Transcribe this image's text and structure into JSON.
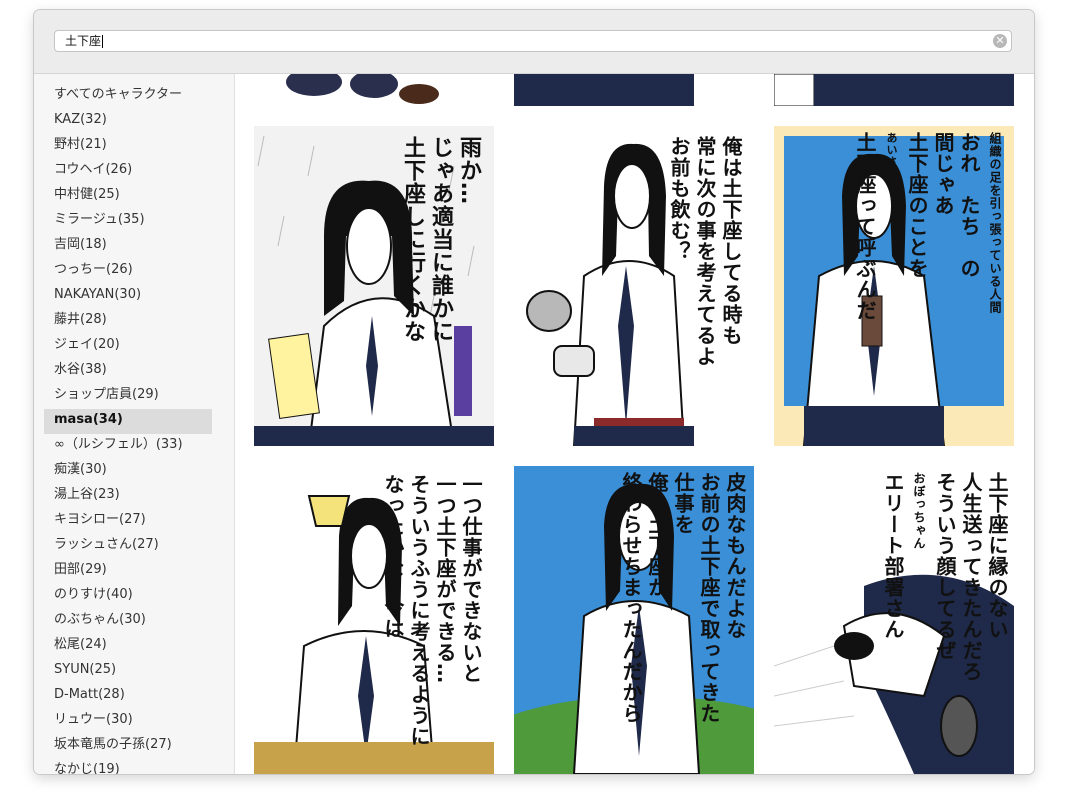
{
  "search": {
    "value": "土下座"
  },
  "sidebar": {
    "items": [
      {
        "label": "すべてのキャラクター"
      },
      {
        "label": "KAZ(32)"
      },
      {
        "label": "野村(21)"
      },
      {
        "label": "コウヘイ(26)"
      },
      {
        "label": "中村健(25)"
      },
      {
        "label": "ミラージュ(35)"
      },
      {
        "label": "吉岡(18)"
      },
      {
        "label": "つっちー(26)"
      },
      {
        "label": "NAKAYAN(30)"
      },
      {
        "label": "藤井(28)"
      },
      {
        "label": "ジェイ(20)"
      },
      {
        "label": "水谷(38)"
      },
      {
        "label": "ショップ店員(29)"
      },
      {
        "label": "masa(34)"
      },
      {
        "label": "∞（ルシフェル）(33)"
      },
      {
        "label": "痴漢(30)"
      },
      {
        "label": "湯上谷(23)"
      },
      {
        "label": "キヨシロー(27)"
      },
      {
        "label": "ラッシュさん(27)"
      },
      {
        "label": "田部(29)"
      },
      {
        "label": "のりすけ(40)"
      },
      {
        "label": "のぶちゃん(30)"
      },
      {
        "label": "松尾(24)"
      },
      {
        "label": "SYUN(25)"
      },
      {
        "label": "D-Matt(28)"
      },
      {
        "label": "リュウー(30)"
      },
      {
        "label": "坂本竜馬の子孫(27)"
      },
      {
        "label": "なかじ(19)"
      }
    ],
    "selected": "masa(34)"
  },
  "stickers": [
    {
      "lines": [
        "雨か…",
        "じゃあ適当に誰かに",
        "土下座しに行くかな"
      ]
    },
    {
      "lines": [
        "俺は土下座してる時も",
        "常に次の事を考えてるよ",
        "お前も飲む？"
      ]
    },
    {
      "lines": [
        "組織の足を引っ張っている人間",
        "おれ　たち　の",
        "間じゃあ",
        "土下座のことを",
        "あいさつ",
        "土下座って呼ぶんだ"
      ]
    },
    {
      "lines": [
        "一つ仕事ができないと",
        "一つ土下座ができる…",
        "そういうふうに考えるように",
        "なったかな−今は"
      ]
    },
    {
      "lines": [
        "皮肉なもんだよな",
        "お前の土下座で取ってきた",
        "仕事を",
        "俺の土下座が",
        "終わらせちまったんだから"
      ]
    },
    {
      "lines": [
        "土下座に縁のない",
        "人生送ってきたんだろ",
        "そういう顔してるぜ",
        "おぼっちゃん",
        "エリート部署さん"
      ]
    }
  ],
  "colors": {
    "accent": "#dcdcdc",
    "shirt": "#ffffff",
    "tie": "#1f2a4a",
    "hair": "#111111",
    "sky": "#3a8fd6",
    "grass": "#4f9a3a",
    "bg_yellow": "#fbe9b8"
  }
}
